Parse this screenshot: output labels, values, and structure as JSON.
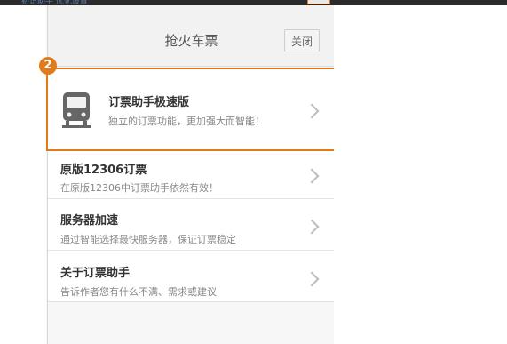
{
  "topbar": {
    "link_text": "初识助手   优化设置"
  },
  "panel": {
    "title": "抢火车票",
    "close_label": "关闭",
    "step_number": "2",
    "items": [
      {
        "title": "订票助手极速版",
        "desc": "独立的订票功能，更加强大而智能！",
        "icon": "train-icon"
      },
      {
        "title": "原版12306订票",
        "desc": "在原版12306中订票助手依然有效！"
      },
      {
        "title": "服务器加速",
        "desc": "通过智能选择最快服务器，保证订票稳定"
      },
      {
        "title": "关于订票助手",
        "desc": "告诉作者您有什么不满、需求或建议"
      }
    ]
  },
  "colors": {
    "accent": "#e07a1a",
    "panel_bg": "#f7f7f7",
    "item_bg": "#ffffff"
  }
}
